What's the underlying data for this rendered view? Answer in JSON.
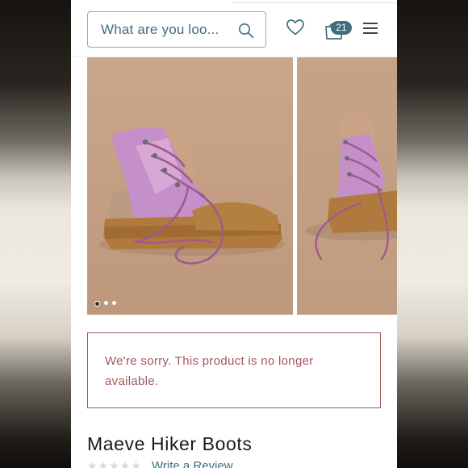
{
  "header": {
    "search_placeholder": "What are you loo...",
    "cart_count": "21",
    "icons": [
      "search-icon",
      "heart-icon",
      "shopping-bag-icon",
      "menu-icon"
    ]
  },
  "gallery": {
    "dots": 3,
    "active_dot": 1
  },
  "notice": {
    "text": "We're sorry. This product is no longer available."
  },
  "product": {
    "title": "Maeve Hiker Boots",
    "review_link": "Write a Review",
    "stars": 5
  },
  "colors": {
    "accent": "#3d6f7d",
    "notice": "#a3565a"
  }
}
